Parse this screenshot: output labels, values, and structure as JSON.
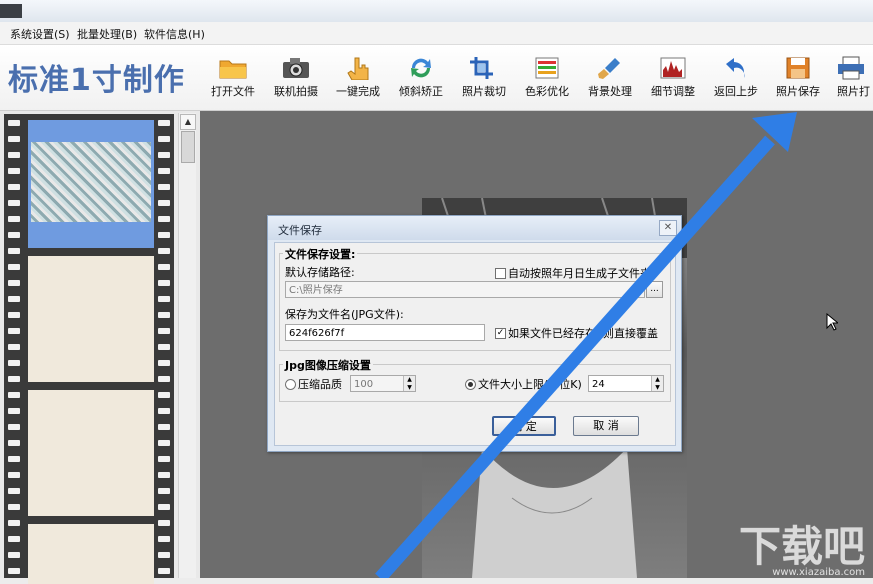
{
  "menu": {
    "items": [
      {
        "label": "系统设置(S)"
      },
      {
        "label": "批量处理(B)"
      },
      {
        "label": "软件信息(H)"
      }
    ]
  },
  "app": {
    "title": "标准1寸制作"
  },
  "toolbar": {
    "items": [
      {
        "label": "打开文件",
        "icon": "folder-icon"
      },
      {
        "label": "联机拍摄",
        "icon": "camera-icon"
      },
      {
        "label": "一键完成",
        "icon": "hand-pointer-icon"
      },
      {
        "label": "倾斜矫正",
        "icon": "rotate-icon"
      },
      {
        "label": "照片裁切",
        "icon": "crop-icon"
      },
      {
        "label": "色彩优化",
        "icon": "color-bars-icon"
      },
      {
        "label": "背景处理",
        "icon": "brush-icon"
      },
      {
        "label": "细节调整",
        "icon": "histogram-icon"
      },
      {
        "label": "返回上步",
        "icon": "undo-icon"
      },
      {
        "label": "照片保存",
        "icon": "save-icon"
      },
      {
        "label": "照片打",
        "icon": "printer-icon"
      }
    ]
  },
  "dialog": {
    "title": "文件保存",
    "save_settings_title": "文件保存设置:",
    "default_path_label": "默认存储路径:",
    "auto_subfolder_label": "自动按照年月日生成子文件夹",
    "auto_subfolder_checked": false,
    "path_value": "C:\\照片保存",
    "browse_label": "...",
    "filename_label": "保存为文件名(JPG文件):",
    "filename_value": "624f626f7f",
    "overwrite_label": "如果文件已经存在, 则直接覆盖",
    "overwrite_checked": true,
    "jpg_title": "Jpg图像压缩设置",
    "quality_label": "压缩品质",
    "quality_value": "100",
    "quality_selected": false,
    "size_limit_label": "文件大小上限(单位K)",
    "size_limit_value": "24",
    "size_limit_selected": true,
    "ok_label": "确 定",
    "cancel_label": "取 消"
  },
  "watermark": {
    "main": "下载吧",
    "sub": "www.xiazaiba.com"
  },
  "colors": {
    "accent": "#4a6fae",
    "arrow": "#2f7ee6",
    "selection": "#6f9be0"
  }
}
